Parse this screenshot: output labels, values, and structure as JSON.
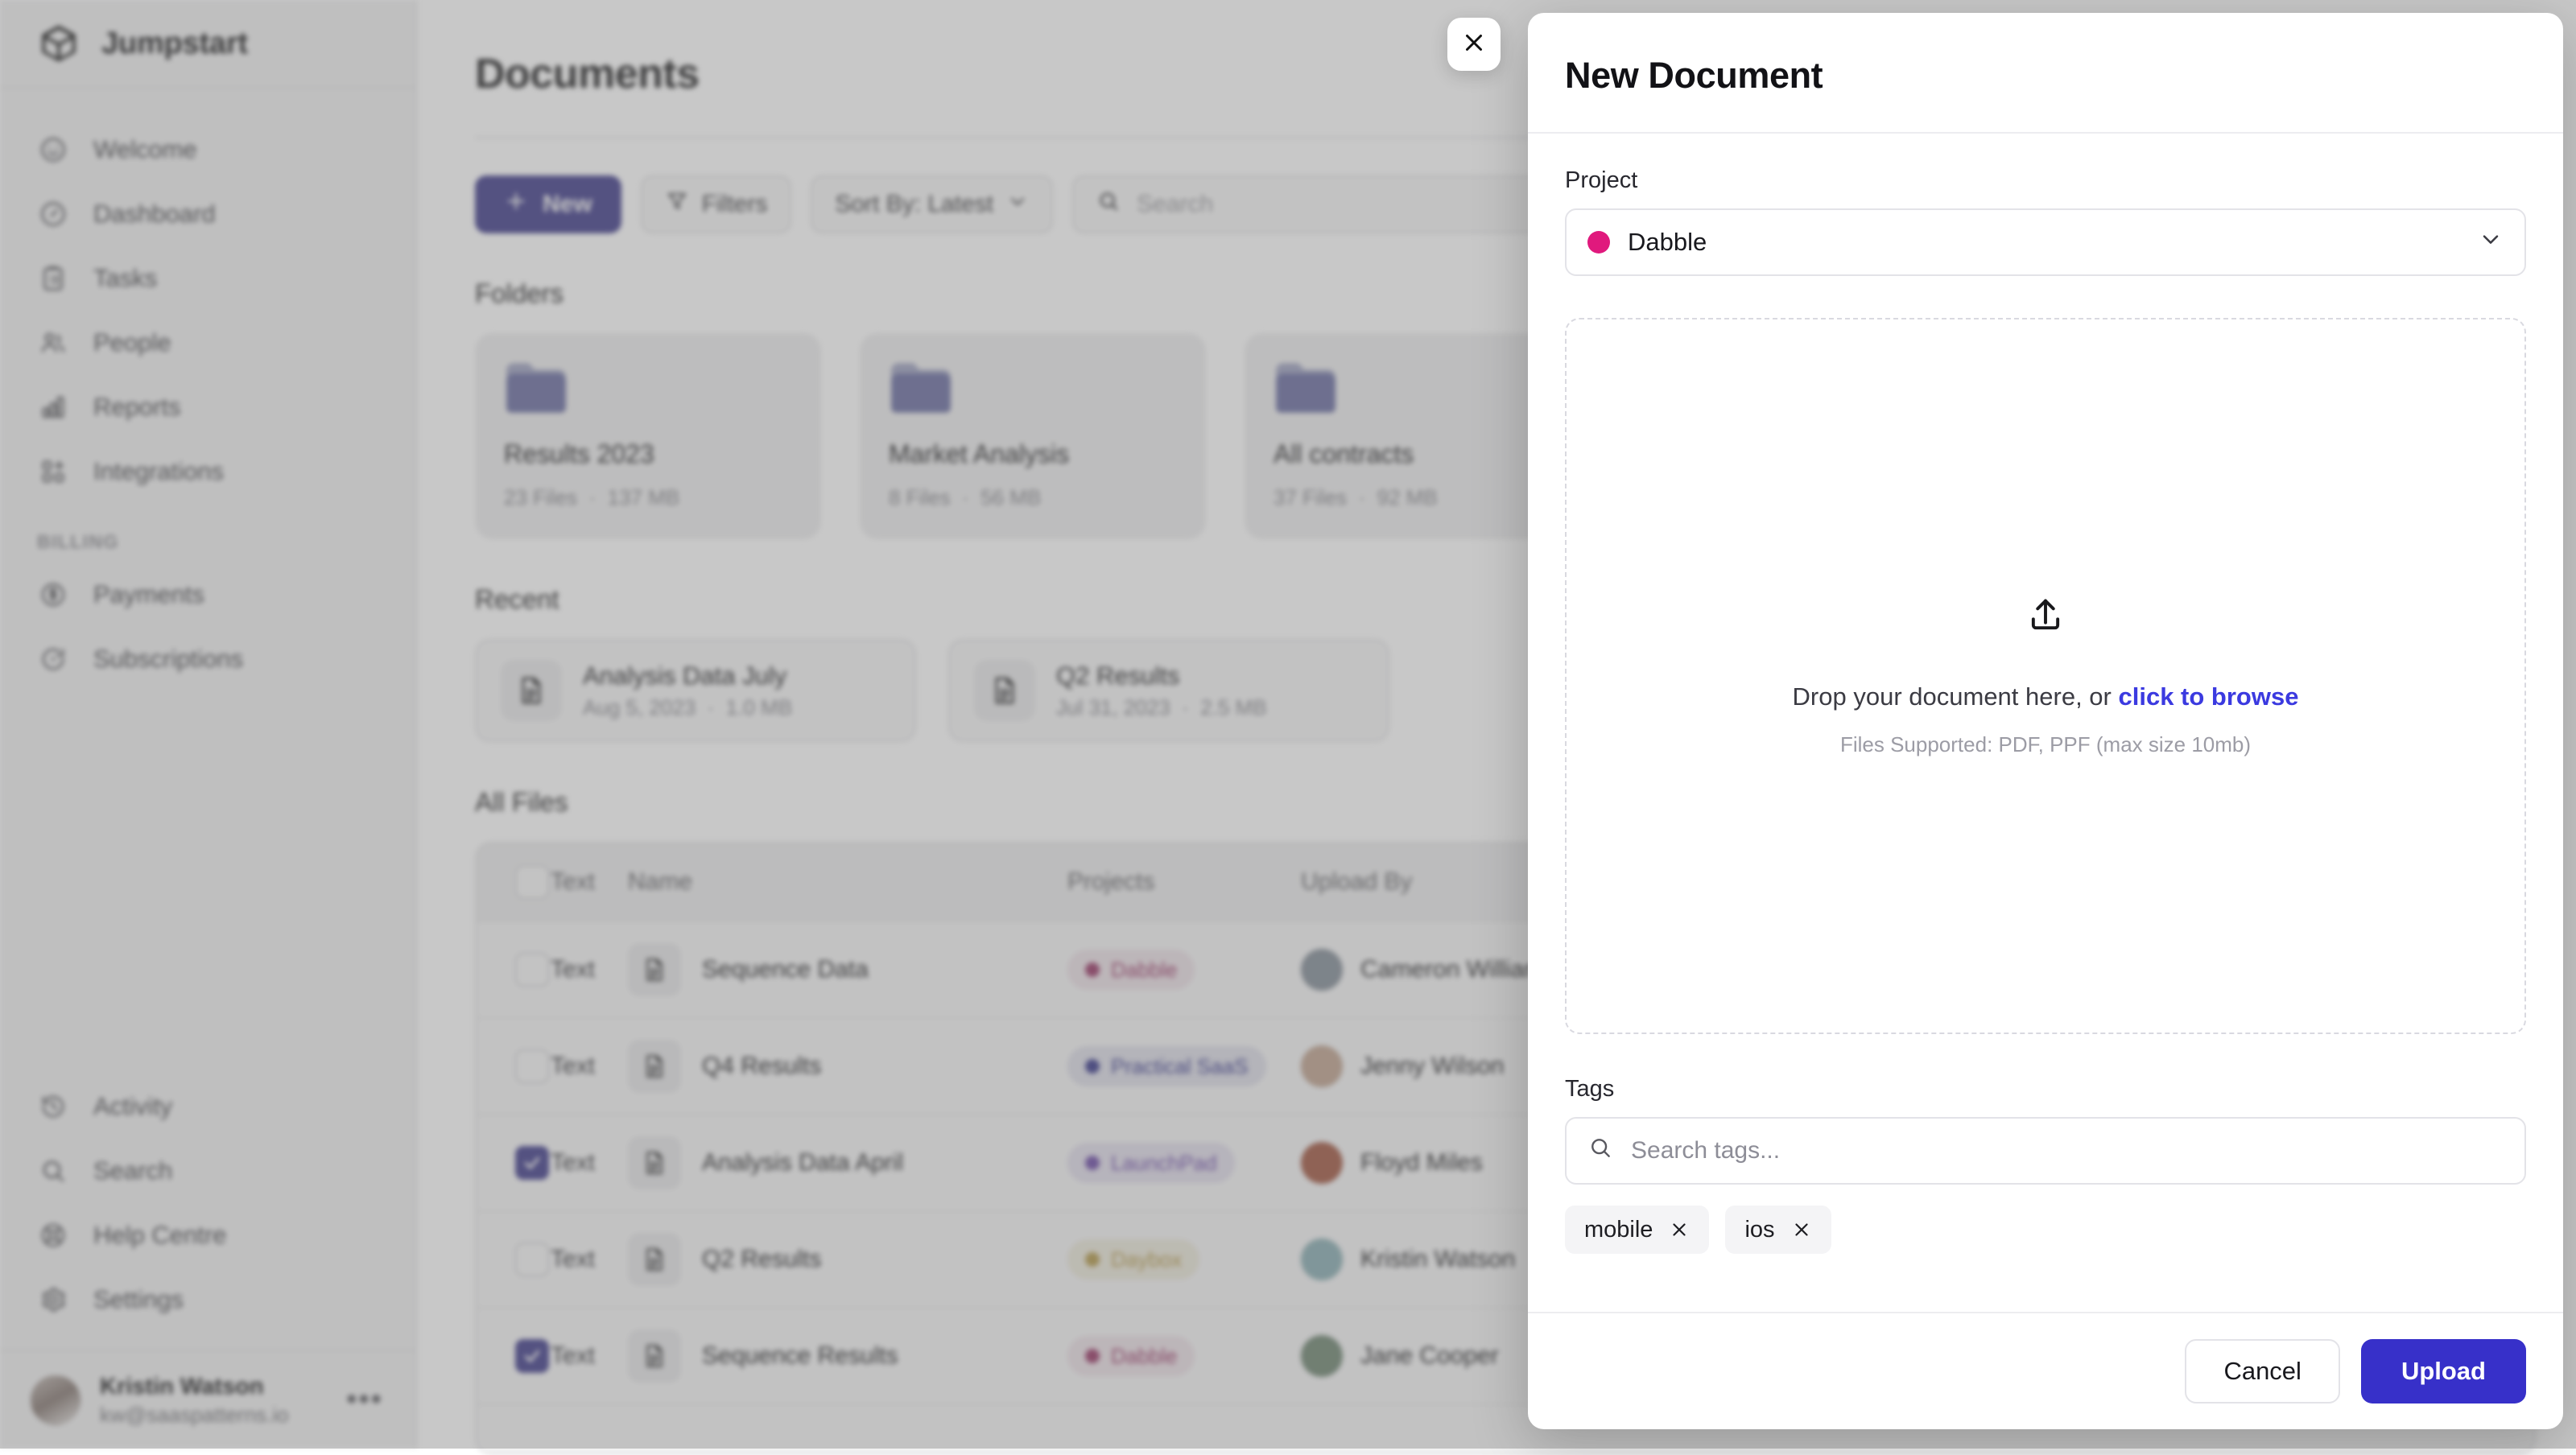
{
  "brand": {
    "name": "Jumpstart",
    "logo_icon": "cube-logo-icon"
  },
  "sidebar": {
    "primary_items": [
      {
        "label": "Welcome",
        "icon": "smiley-icon"
      },
      {
        "label": "Dashboard",
        "icon": "gauge-icon"
      },
      {
        "label": "Tasks",
        "icon": "clipboard-icon"
      },
      {
        "label": "People",
        "icon": "users-icon"
      },
      {
        "label": "Reports",
        "icon": "bar-chart-icon"
      },
      {
        "label": "Integrations",
        "icon": "squares-plus-icon"
      }
    ],
    "billing_label": "BILLING",
    "billing_items": [
      {
        "label": "Payments",
        "icon": "dollar-circle-icon"
      },
      {
        "label": "Subscriptions",
        "icon": "refresh-circle-icon"
      }
    ],
    "bottom_items": [
      {
        "label": "Activity",
        "icon": "clock-history-icon"
      },
      {
        "label": "Search",
        "icon": "search-icon"
      },
      {
        "label": "Help Centre",
        "icon": "lifebuoy-icon"
      },
      {
        "label": "Settings",
        "icon": "gear-icon"
      }
    ],
    "user": {
      "name": "Kristin Watson",
      "email": "kw@saaspatterns.io",
      "more_icon": "ellipsis-icon"
    }
  },
  "main": {
    "page_title": "Documents",
    "toolbar": {
      "new_label": "New",
      "new_icon": "plus-icon",
      "filters_label": "Filters",
      "filters_icon": "funnel-icon",
      "sort_label": "Sort By: Latest",
      "sort_icon": "chevron-down-icon",
      "search_placeholder": "Search",
      "search_icon": "search-icon"
    },
    "folders_heading": "Folders",
    "folders": [
      {
        "name": "Results 2023",
        "files": "23 Files",
        "size": "137 MB"
      },
      {
        "name": "Market Analysis",
        "files": "8 Files",
        "size": "56 MB"
      },
      {
        "name": "All contracts",
        "files": "37 Files",
        "size": "92 MB"
      }
    ],
    "recent_heading": "Recent",
    "recent": [
      {
        "name": "Analysis Data July",
        "date": "Aug 5, 2023",
        "size": "1.0 MB"
      },
      {
        "name": "Q2 Results",
        "date": "Jul 31, 2023",
        "size": "2.5 MB"
      }
    ],
    "all_files_heading": "All Files",
    "table": {
      "columns": [
        "Text",
        "Name",
        "Projects",
        "Upload By"
      ],
      "rows": [
        {
          "checked": false,
          "text": "Text",
          "name": "Sequence Data",
          "project": "Dabble",
          "project_color": "#d81b77",
          "project_bg": "#fae4ef",
          "user": "Cameron Williamson",
          "avatar": "#7c8fa3"
        },
        {
          "checked": false,
          "text": "Text",
          "name": "Q4 Results",
          "project": "Practical SaaS",
          "project_color": "#2c2ccc",
          "project_bg": "#e2e2f6",
          "user": "Jenny Wilson",
          "avatar": "#d9a07a"
        },
        {
          "checked": true,
          "text": "Text",
          "name": "Analysis Data April",
          "project": "LaunchPad",
          "project_color": "#7c3aed",
          "project_bg": "#e9e1fb",
          "user": "Floyd Miles",
          "avatar": "#d8461c"
        },
        {
          "checked": false,
          "text": "Text",
          "name": "Q2 Results",
          "project": "Daybox",
          "project_color": "#cc9900",
          "project_bg": "#f6efd3",
          "user": "Kristin Watson",
          "avatar": "#6fb6c0"
        },
        {
          "checked": true,
          "text": "Text",
          "name": "Sequence Results",
          "project": "Dabble",
          "project_color": "#d81b77",
          "project_bg": "#fae4ef",
          "user": "Jane Cooper",
          "avatar": "#5e8a63"
        }
      ]
    }
  },
  "modal": {
    "close_icon": "close-icon",
    "title": "New Document",
    "project_label": "Project",
    "project_value": "Dabble",
    "project_dot_color": "#e0197d",
    "project_chevron_icon": "chevron-down-icon",
    "dropzone": {
      "icon": "upload-icon",
      "prompt": "Drop your document here, or ",
      "browse_link": "click to browse",
      "supported": "Files Supported: PDF, PPF (max size 10mb)"
    },
    "tags_label": "Tags",
    "tags_placeholder": "Search tags...",
    "tags_search_icon": "search-icon",
    "tags": [
      {
        "label": "mobile",
        "remove_icon": "close-icon"
      },
      {
        "label": "ios",
        "remove_icon": "close-icon"
      }
    ],
    "cancel_label": "Cancel",
    "upload_label": "Upload",
    "accent_color": "#3730c9"
  }
}
